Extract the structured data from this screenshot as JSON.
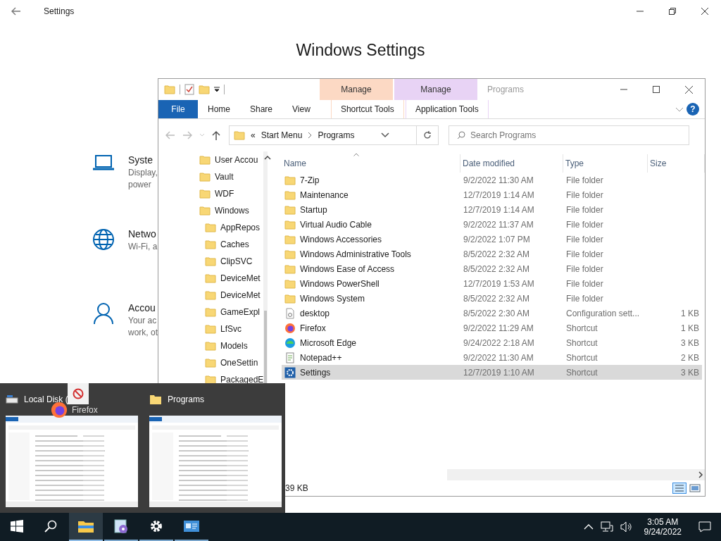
{
  "settings": {
    "title": "Settings",
    "heading": "Windows Settings",
    "categories": [
      {
        "kind": "laptop",
        "name": "Syste",
        "lines": [
          "Display,",
          "power"
        ]
      },
      {
        "kind": "globe",
        "name": "Netwo",
        "lines": [
          "Wi-Fi, a"
        ]
      },
      {
        "kind": "person",
        "name": "Accou",
        "lines": [
          "Your ac",
          "work, ot"
        ]
      }
    ]
  },
  "explorer": {
    "title": "Programs",
    "context_groups": [
      {
        "header": "Manage",
        "tab": "Shortcut Tools",
        "color": "#fcd9c4"
      },
      {
        "header": "Manage",
        "tab": "Application Tools",
        "color": "#e8d3f5"
      }
    ],
    "ribbon_tabs": [
      {
        "label": "File",
        "kind": "file"
      },
      {
        "label": "Home",
        "kind": "plain"
      },
      {
        "label": "Share",
        "kind": "plain"
      },
      {
        "label": "View",
        "kind": "plain"
      }
    ],
    "help": "?",
    "address": {
      "overflow": "«",
      "segments": [
        "Start Menu",
        "Programs"
      ]
    },
    "search": {
      "placeholder": "Search Programs"
    },
    "nav": [
      {
        "label": "User Accou"
      },
      {
        "label": "Vault"
      },
      {
        "label": "WDF"
      },
      {
        "label": "Windows",
        "children": [
          {
            "label": "AppRepos"
          },
          {
            "label": "Caches"
          },
          {
            "label": "ClipSVC"
          },
          {
            "label": "DeviceMet"
          },
          {
            "label": "DeviceMet"
          },
          {
            "label": "GameExpl"
          },
          {
            "label": "LfSvc"
          },
          {
            "label": "Models"
          },
          {
            "label": "OneSettin"
          },
          {
            "label": "PackagedE"
          }
        ]
      }
    ],
    "columns": [
      "Name",
      "Date modified",
      "Type",
      "Size"
    ],
    "rows": [
      {
        "kind": "folder",
        "name": "7-Zip",
        "date": "9/2/2022 11:30 AM",
        "type": "File folder",
        "selected": false
      },
      {
        "kind": "folder",
        "name": "Maintenance",
        "date": "12/7/2019 1:14 AM",
        "type": "File folder",
        "selected": false
      },
      {
        "kind": "folder",
        "name": "Startup",
        "date": "12/7/2019 1:14 AM",
        "type": "File folder",
        "selected": false
      },
      {
        "kind": "folder",
        "name": "Virtual Audio Cable",
        "date": "9/2/2022 11:37 AM",
        "type": "File folder",
        "selected": false
      },
      {
        "kind": "folder",
        "name": "Windows Accessories",
        "date": "9/2/2022 1:07 PM",
        "type": "File folder",
        "selected": false
      },
      {
        "kind": "folder",
        "name": "Windows Administrative Tools",
        "date": "8/5/2022 2:32 AM",
        "type": "File folder",
        "selected": false
      },
      {
        "kind": "folder",
        "name": "Windows Ease of Access",
        "date": "8/5/2022 2:32 AM",
        "type": "File folder",
        "selected": false
      },
      {
        "kind": "folder",
        "name": "Windows PowerShell",
        "date": "12/7/2019 1:53 AM",
        "type": "File folder",
        "selected": false
      },
      {
        "kind": "folder",
        "name": "Windows System",
        "date": "8/5/2022 2:32 AM",
        "type": "File folder",
        "selected": false
      },
      {
        "kind": "config",
        "name": "desktop",
        "date": "8/5/2022 2:30 AM",
        "type": "Configuration sett...",
        "size": "1 KB",
        "selected": false
      },
      {
        "kind": "firefox",
        "name": "Firefox",
        "date": "9/2/2022 11:29 AM",
        "type": "Shortcut",
        "size": "1 KB",
        "selected": false
      },
      {
        "kind": "edge",
        "name": "Microsoft Edge",
        "date": "9/24/2022 2:18 AM",
        "type": "Shortcut",
        "size": "3 KB",
        "selected": false
      },
      {
        "kind": "notepad",
        "name": "Notepad++",
        "date": "9/2/2022 11:30 AM",
        "type": "Shortcut",
        "size": "2 KB",
        "selected": false
      },
      {
        "kind": "settings",
        "name": "Settings",
        "date": "12/7/2019 1:10 AM",
        "type": "Shortcut",
        "size": "3 KB",
        "selected": true
      }
    ],
    "status": "39 KB"
  },
  "previews": {
    "windows": [
      {
        "kind": "drive",
        "title": "Local Disk ("
      },
      {
        "kind": "folder",
        "title": "Programs"
      }
    ],
    "drag_label": "Firefox"
  },
  "taskbar": {
    "apps": [
      {
        "kind": "explorer",
        "selected": true
      },
      {
        "kind": "installer",
        "selected": false
      },
      {
        "kind": "gear",
        "selected": false
      },
      {
        "kind": "panel",
        "selected": false
      }
    ],
    "time": "3:05 AM",
    "date": "9/24/2022"
  }
}
